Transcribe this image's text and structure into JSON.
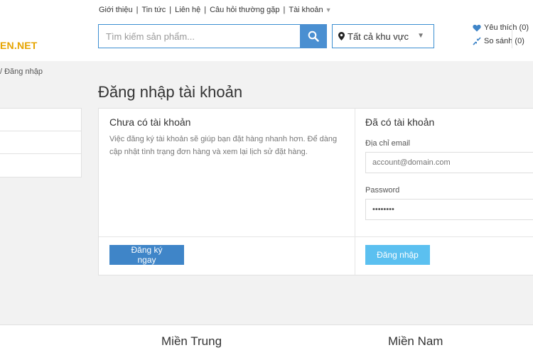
{
  "header": {
    "top_links": [
      "Giới thiệu",
      "Tin tức",
      "Liên hệ",
      "Câu hỏi thường gặp",
      "Tài khoản"
    ],
    "logo_text": "EN.NET",
    "search": {
      "placeholder": "Tìm kiếm sản phẩm...",
      "value": ""
    },
    "region": {
      "selected": "Tất cả khu vực"
    },
    "wishlist_label": "Yêu thích (0)",
    "compare_label": "So sánh (0)"
  },
  "breadcrumb": "/ Đăng nhập",
  "page_title": "Đăng nhập tài khoản",
  "register": {
    "title": "Chưa có tài khoản",
    "description": "Việc đăng ký tài khoản sẽ giúp bạn đặt hàng nhanh hơn. Để dàng cập nhật tình trạng đơn hàng và xem lại lịch sử đặt hàng.",
    "button_label": "Đăng ký ngay"
  },
  "login": {
    "title": "Đã có tài khoản",
    "email_label": "Địa chỉ email",
    "email_placeholder": "account@domain.com",
    "password_label": "Password",
    "password_value": "password",
    "button_label": "Đăng nhập"
  },
  "footer": {
    "columns": [
      "Miền Trung",
      "Miền Nam"
    ]
  },
  "colors": {
    "accent": "#3f85c8",
    "login_button": "#5bc0f0",
    "logo": "#e6a400"
  }
}
